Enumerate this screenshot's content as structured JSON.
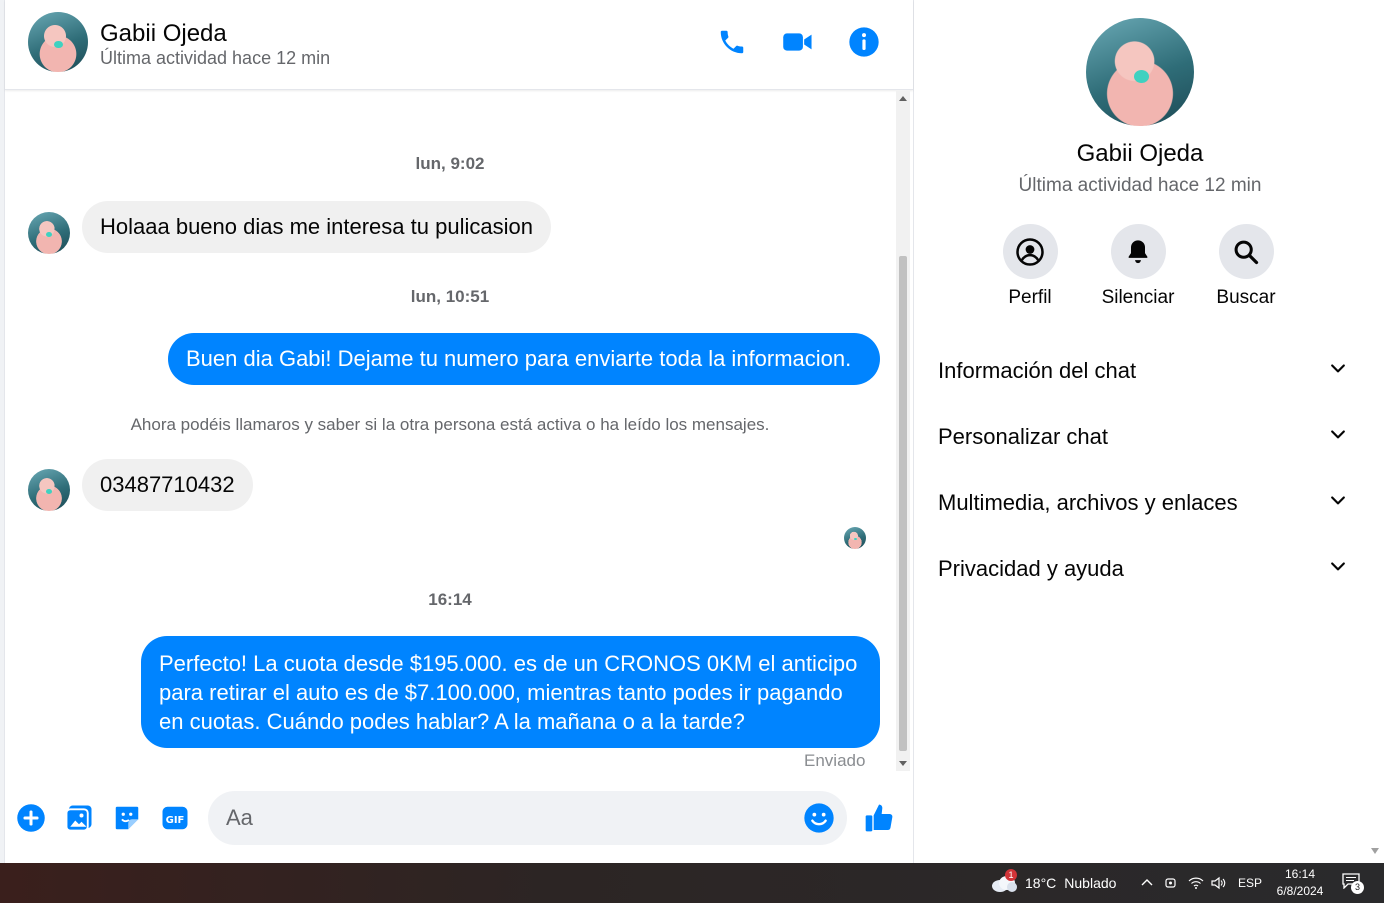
{
  "contact": {
    "name": "Gabii Ojeda",
    "last_active": "Última actividad hace 12 min"
  },
  "header_icons": [
    "phone-icon",
    "video-camera-icon",
    "info-icon"
  ],
  "messages": {
    "ts1": "lun, 9:02",
    "in1": "Holaaa bueno dias me interesa tu pulicasion",
    "ts2": "lun, 10:51",
    "out1": "Buen dia Gabi! Dejame tu numero para enviarte toda la informacion.",
    "notice": "Ahora podéis llamaros y saber si la otra persona está activa o ha leído los mensajes.",
    "in2": "03487710432",
    "ts3": "16:14",
    "out2_line1": "Perfecto! La cuota desde $195.000. es de un CRONOS 0KM el anticipo",
    "out2_line2": "para retirar el auto es de $7.100.000, mientras tanto podes ir pagando",
    "out2_line3": "en cuotas. Cuándo podes hablar? A la mañana o a la tarde?",
    "status": "Enviado"
  },
  "composer": {
    "placeholder": "Aa",
    "icons": [
      "plus-icon",
      "image-icon",
      "sticker-icon",
      "gif-icon",
      "emoji-icon",
      "like-icon"
    ]
  },
  "panel": {
    "name": "Gabii Ojeda",
    "last_active": "Última actividad hace 12 min",
    "actions": [
      {
        "label": "Perfil",
        "icon": "profile-icon"
      },
      {
        "label": "Silenciar",
        "icon": "bell-icon"
      },
      {
        "label": "Buscar",
        "icon": "search-icon"
      }
    ],
    "sections": [
      "Información del chat",
      "Personalizar chat",
      "Multimedia, archivos y enlaces",
      "Privacidad y ayuda"
    ]
  },
  "taskbar": {
    "weather_temp": "18°C",
    "weather_desc": "Nublado",
    "weather_badge": "1",
    "language": "ESP",
    "time": "16:14",
    "date": "6/8/2024",
    "notification_count": "3"
  },
  "colors": {
    "accent": "#0084ff",
    "incoming_bubble": "#f0f0f0",
    "muted_text": "#65676b"
  }
}
